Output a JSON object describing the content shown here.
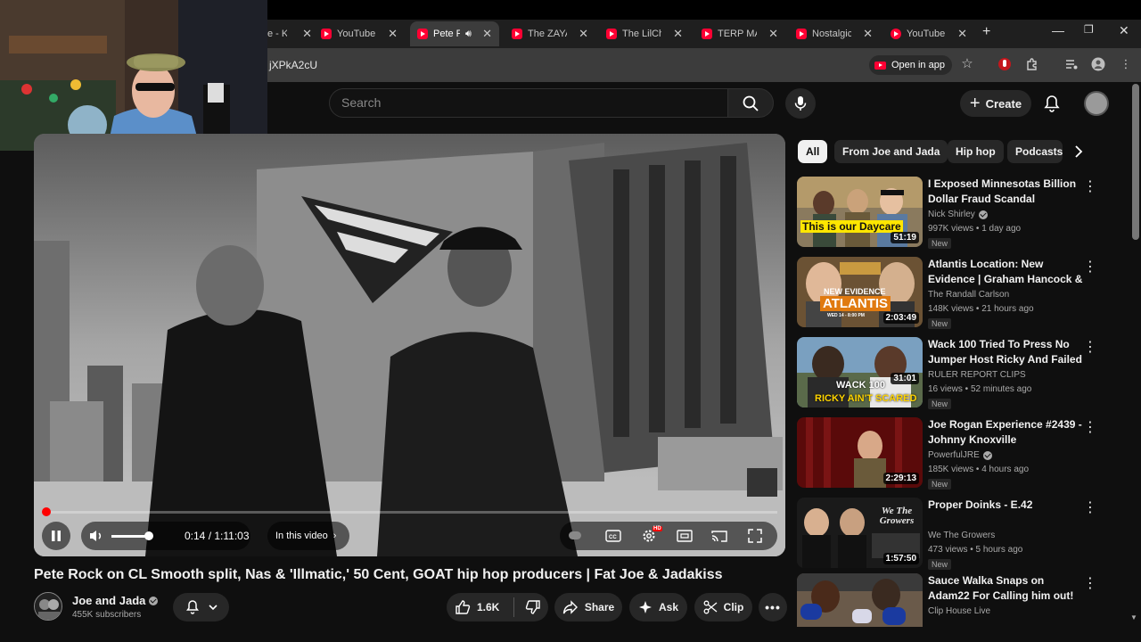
{
  "browser": {
    "tabs": [
      {
        "label": "e - K"
      },
      {
        "label": "YouTube M"
      },
      {
        "label": "Pete Ro"
      },
      {
        "label": "The ZAYAI"
      },
      {
        "label": "The LilChik"
      },
      {
        "label": "TERP MAN"
      },
      {
        "label": "Nostalgic"
      },
      {
        "label": "YouTube M"
      }
    ],
    "url": "jXPkA2cU",
    "open_in_app": "Open in app"
  },
  "header": {
    "search_placeholder": "Search",
    "create_label": "Create"
  },
  "player": {
    "time": "0:14 / 1:11:03",
    "in_this_video": "In this video",
    "progress": 0.003
  },
  "video": {
    "title": "Pete Rock on CL Smooth split, Nas & 'Illmatic,' 50 Cent, GOAT hip hop producers | Fat Joe & Jadakiss",
    "channel": "Joe and Jada",
    "subscribers": "455K subscribers",
    "likes": "1.6K",
    "share": "Share",
    "ask": "Ask",
    "clip": "Clip"
  },
  "chips": [
    {
      "label": "All"
    },
    {
      "label": "From Joe and Jada"
    },
    {
      "label": "Hip hop"
    },
    {
      "label": "Podcasts"
    }
  ],
  "recommendations": [
    {
      "title": "I Exposed Minnesotas Billion Dollar Fraud Scandal",
      "channel": "Nick Shirley",
      "meta": "997K views • 1 day ago",
      "badge": "New",
      "duration": "51:19",
      "thumb_text": "This is our Daycare"
    },
    {
      "title": "Atlantis Location: New Evidence | Graham Hancock & Randall ...",
      "channel": "The Randall Carlson",
      "meta": "148K views • 21 hours ago",
      "badge": "New",
      "duration": "2:03:49",
      "thumb_text": "NEW EVIDENCE",
      "thumb_text2": "ATLANTIS",
      "thumb_text3": "WED 14 - 8:00 PM"
    },
    {
      "title": "Wack 100 Tried To Press No Jumper Host Ricky And Failed ...",
      "channel": "RULER REPORT CLIPS",
      "meta": "16 views • 52 minutes ago",
      "badge": "New",
      "duration": "31:01",
      "thumb_text": "WACK 100",
      "thumb_text2": "RICKY AIN'T SCARED"
    },
    {
      "title": "Joe Rogan Experience #2439 - Johnny Knoxville",
      "channel": "PowerfulJRE",
      "meta": "185K views • 4 hours ago",
      "badge": "New",
      "duration": "2:29:13"
    },
    {
      "title": "Proper Doinks - E.42",
      "channel": "We The Growers",
      "meta": "473 views • 5 hours ago",
      "badge": "New",
      "duration": "1:57:50",
      "thumb_text": "We The Growers"
    },
    {
      "title": "Sauce Walka Snaps on Adam22 For Calling him out! 😳",
      "channel": "Clip House Live",
      "meta": "",
      "badge": "",
      "duration": ""
    }
  ]
}
